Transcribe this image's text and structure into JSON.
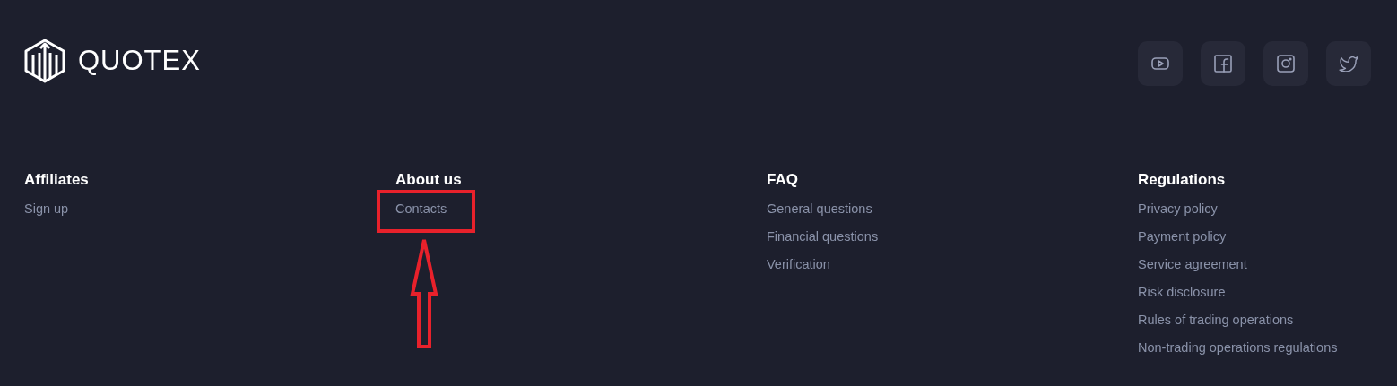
{
  "brand": {
    "name": "QUOTEX"
  },
  "social": [
    {
      "kind": "youtube"
    },
    {
      "kind": "facebook"
    },
    {
      "kind": "instagram"
    },
    {
      "kind": "twitter"
    }
  ],
  "columns": [
    {
      "heading": "Affiliates",
      "links": [
        {
          "label": "Sign up",
          "highlighted": false
        }
      ]
    },
    {
      "heading": "About us",
      "links": [
        {
          "label": "Contacts",
          "highlighted": true
        }
      ]
    },
    {
      "heading": "FAQ",
      "links": [
        {
          "label": "General questions",
          "highlighted": false
        },
        {
          "label": "Financial questions",
          "highlighted": false
        },
        {
          "label": "Verification",
          "highlighted": false
        }
      ]
    },
    {
      "heading": "Regulations",
      "links": [
        {
          "label": "Privacy policy",
          "highlighted": false
        },
        {
          "label": "Payment policy",
          "highlighted": false
        },
        {
          "label": "Service agreement",
          "highlighted": false
        },
        {
          "label": "Risk disclosure",
          "highlighted": false
        },
        {
          "label": "Rules of trading operations",
          "highlighted": false
        },
        {
          "label": "Non-trading operations regulations",
          "highlighted": false
        }
      ]
    }
  ]
}
